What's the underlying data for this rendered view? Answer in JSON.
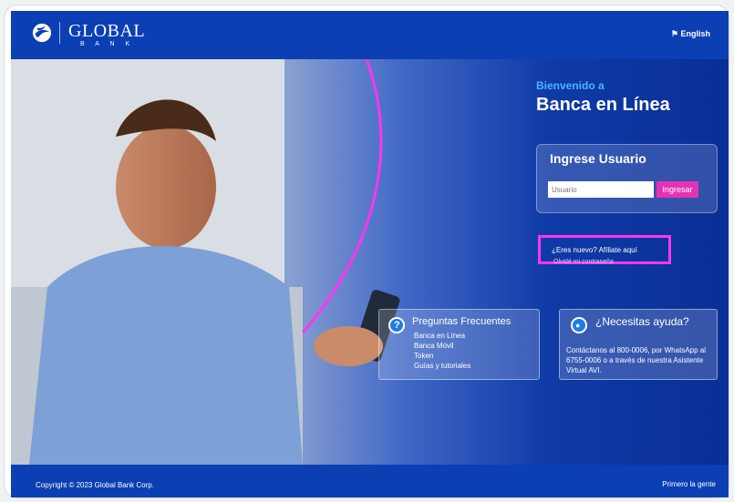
{
  "header": {
    "brand": "GLOBAL",
    "brand_sub": "B A N K",
    "language": "English"
  },
  "welcome": {
    "small": "Bienvenido a",
    "title": "Banca en Línea"
  },
  "login": {
    "title": "Ingrese Usuario",
    "placeholder": "Usuario",
    "button": "Ingresar"
  },
  "links": {
    "affiliate": "¿Eres nuevo? Afíliate aquí",
    "forgot": "Olvidé mi contraseña"
  },
  "faq": {
    "title": "Preguntas Frecuentes",
    "items": [
      "Banca en Línea",
      "Banca Móvil",
      "Token",
      "Guías y tutoriales"
    ]
  },
  "help": {
    "title": "¿Necesitas ayuda?",
    "text": "Contáctanos al 800-0006, por WhatsApp al 6755-0006 o a través de nuestra Asistente Virtual AVI."
  },
  "footer": {
    "copyright": "Copyright © 2023 Global Bank Corp.",
    "tagline": "Primero la gente"
  },
  "colors": {
    "header": "#0b3fb3",
    "accent": "#e632b5",
    "highlight": "#ff35ef",
    "welcome_small": "#44b7ff"
  },
  "icons": [
    "globe-logo-icon",
    "flag-icon",
    "question-icon",
    "chat-bot-icon"
  ]
}
